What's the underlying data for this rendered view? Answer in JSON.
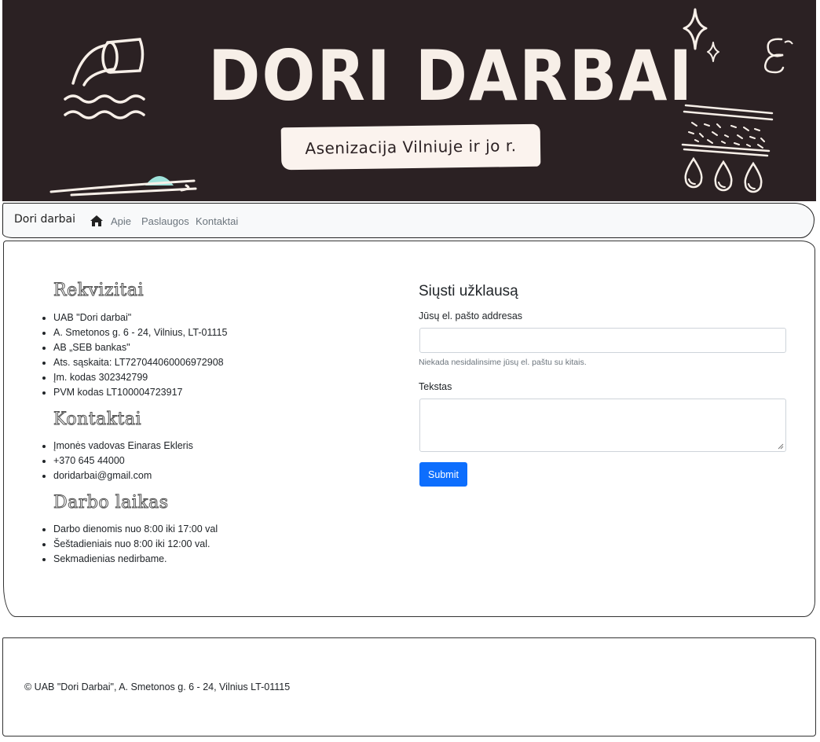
{
  "banner": {
    "title": "DORI DARBAI",
    "subtitle": "Asenizacija Vilniuje ir jo r."
  },
  "navbar": {
    "brand": "Dori darbai",
    "home_icon": "home-icon",
    "links": [
      "Apie",
      "Paslaugos",
      "Kontaktai"
    ]
  },
  "rekvizitai": {
    "heading": "Rekvizitai",
    "items": [
      "UAB \"Dori darbai\"",
      "A. Smetonos g. 6 - 24, Vilnius, LT-01115",
      "AB „SEB bankas\"",
      "Ats. sąskaita: LT727044060006972908",
      "Įm. kodas 302342799",
      "PVM kodas LT100004723917"
    ]
  },
  "kontaktai": {
    "heading": "Kontaktai",
    "items": [
      "Įmonės vadovas Einaras Ekleris",
      "+370 645 44000",
      "doridarbai@gmail.com"
    ]
  },
  "darbo_laikas": {
    "heading": "Darbo laikas",
    "items": [
      "Darbo dienomis nuo 8:00 iki 17:00 val",
      "Šeštadieniais nuo 8:00 iki 12:00 val.",
      "Sekmadienias nedirbame."
    ]
  },
  "form": {
    "title": "Siųsti užklausą",
    "email_label": "Jūsų el. pašto addresas",
    "email_value": "",
    "email_hint": "Niekada nesidalinsime jūsų el. paštu su kitais.",
    "text_label": "Tekstas",
    "text_value": "",
    "submit_label": "Submit"
  },
  "footer": {
    "text": "© UAB \"Dori Darbai\", A. Smetonos g. 6 - 24, Vilnius LT-01115"
  },
  "colors": {
    "banner_bg": "#2b2123",
    "banner_fg": "#f7efe8",
    "accent": "#0d6efd",
    "drop_accent": "#9fe3db"
  }
}
